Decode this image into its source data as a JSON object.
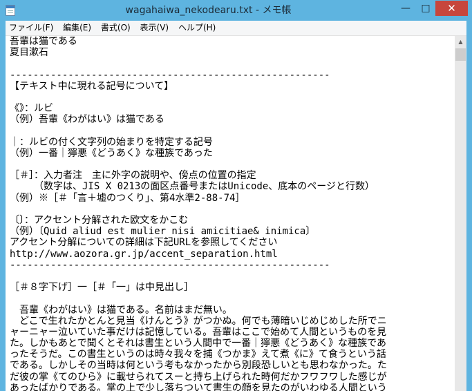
{
  "window": {
    "title": "wagahaiwa_nekodearu.txt - メモ帳",
    "app_icon": "notepad-icon",
    "controls": {
      "minimize": "—",
      "maximize": "□",
      "close": "✕"
    }
  },
  "menu": [
    "ファイル(F)",
    "編集(E)",
    "書式(O)",
    "表示(V)",
    "ヘルプ(H)"
  ],
  "document": {
    "lines": [
      "吾輩は猫である",
      "夏目漱石",
      "",
      "-------------------------------------------------------",
      "【テキスト中に現れる記号について】",
      "",
      "《》：ルビ",
      "（例）吾輩《わがはい》は猫である",
      "",
      "｜：ルビの付く文字列の始まりを特定する記号",
      "（例）一番｜獰悪《どうあく》な種族であった",
      "",
      "［＃］：入力者注　主に外字の説明や、傍点の位置の指定",
      "　　　（数字は、JIS X 0213の面区点番号またはUnicode、底本のページと行数）",
      "（例）※［＃「言＋墟のつくり」、第4水準2-88-74］",
      "",
      "〔〕：アクセント分解された欧文をかこむ",
      "（例）〔Quid aliud est mulier nisi amicitiae& inimica〕",
      "アクセント分解についての詳細は下記URLを参照してください",
      "http://www.aozora.gr.jp/accent_separation.html",
      "-------------------------------------------------------",
      "",
      "［＃８字下げ］一［＃「一」は中見出し］",
      "",
      "　吾輩《わがはい》は猫である。名前はまだ無い。",
      "　どこで生れたかとんと見当《けんとう》がつかぬ。何でも薄暗いじめじめした所でニ",
      "ャーニャー泣いていた事だけは記憶している。吾輩はここで始めて人間というものを見",
      "た。しかもあとで聞くとそれは書生という人間中で一番｜獰悪《どうあく》な種族であ",
      "ったそうだ。この書生というのは時々我々を捕《つかま》えて煮《に》て食うという話",
      "である。しかしその当時は何という考もなかったから別段恐しいとも思わなかった。た",
      "だ彼の掌《てのひら》に載せられてスーと持ち上げられた時何だかフワフワした感じが",
      "あったばかりである。掌の上で少し落ちついて書生の顔を見たのがいわゆる人間という"
    ]
  }
}
